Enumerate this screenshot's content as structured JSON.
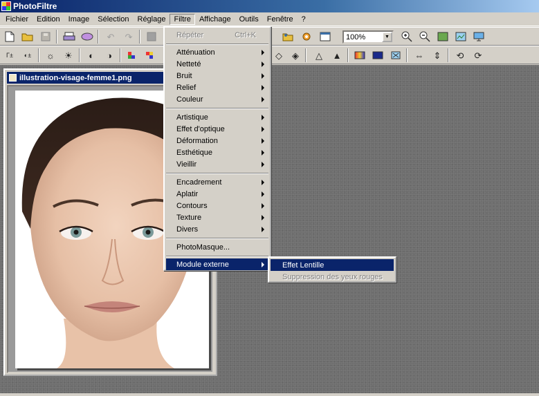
{
  "app": {
    "title": "PhotoFiltre"
  },
  "menubar": [
    "Fichier",
    "Edition",
    "Image",
    "Sélection",
    "Réglage",
    "Filtre",
    "Affichage",
    "Outils",
    "Fenêtre",
    "?"
  ],
  "toolbar": {
    "zoom_value": "100%"
  },
  "document": {
    "title": "illustration-visage-femme1.png"
  },
  "filtre_menu": {
    "repeat": {
      "label": "Répéter",
      "shortcut": "Ctrl+K"
    },
    "group1": [
      "Atténuation",
      "Netteté",
      "Bruit",
      "Relief",
      "Couleur"
    ],
    "group2": [
      "Artistique",
      "Effet d'optique",
      "Déformation",
      "Esthétique",
      "Vieillir"
    ],
    "group3": [
      "Encadrement",
      "Aplatir",
      "Contours",
      "Texture",
      "Divers"
    ],
    "photomasque": "PhotoMasque...",
    "module_externe": "Module externe"
  },
  "submenu": {
    "items": [
      "Effet Lentille",
      "Suppression des yeux rouges"
    ]
  },
  "colors": {
    "title_blue": "#0a246a",
    "face_bg": "#e8c2a8",
    "workspace": "#6e6e6e"
  }
}
